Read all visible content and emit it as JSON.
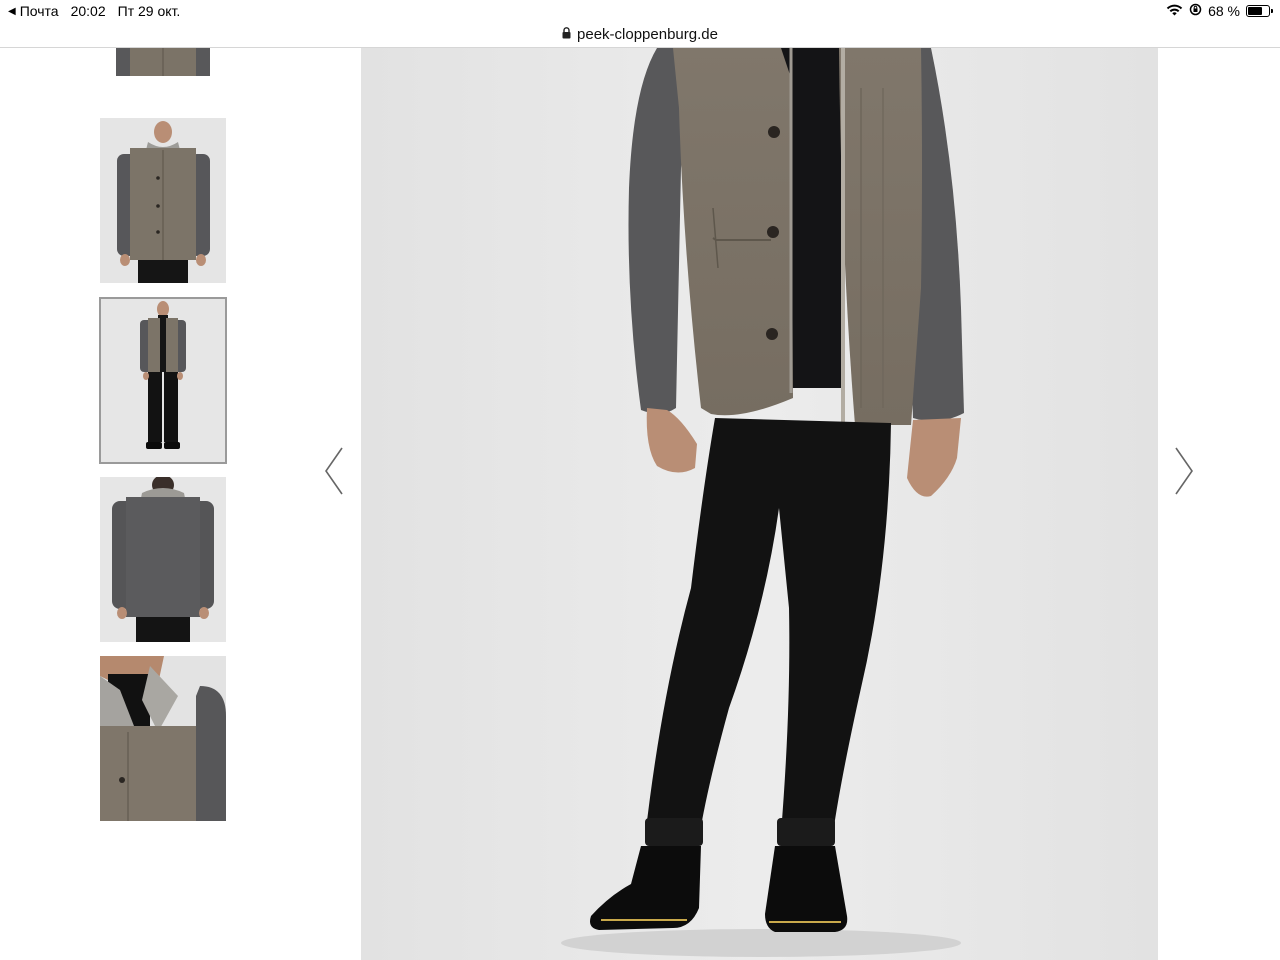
{
  "statusbar": {
    "back_label": "Почта",
    "time": "20:02",
    "date": "Пт 29 окт.",
    "battery": "68 %",
    "battery_level": 0.68
  },
  "browser": {
    "url": "peek-cloppenburg.de"
  },
  "gallery": {
    "thumbnails": [
      {
        "view": "jacket-front-close",
        "selected": false
      },
      {
        "view": "model-front",
        "selected": false
      },
      {
        "view": "model-full-body",
        "selected": true
      },
      {
        "view": "model-back",
        "selected": false
      },
      {
        "view": "collar-detail",
        "selected": false
      }
    ],
    "prev_icon": "chevron-left-icon",
    "next_icon": "chevron-right-icon"
  },
  "colors": {
    "jacket_body": "#7d7468",
    "jacket_sleeve": "#57575a",
    "pants": "#121212",
    "background": "#e6e6e6"
  }
}
